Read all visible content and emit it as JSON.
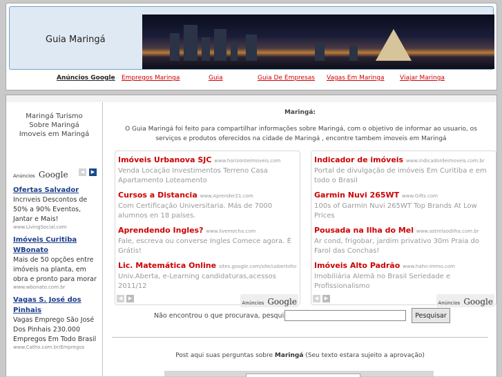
{
  "header": {
    "site_title": "Guia Maringá"
  },
  "nav": {
    "ads_label": "Anúncios Google",
    "links": [
      "Empregos Maringa",
      "Guia",
      "Guia De Empresas",
      "Vagas Em Maringa",
      "Viajar Maringa"
    ]
  },
  "sidebar": {
    "links": [
      "Maringá Turismo",
      "Sobre Maringá",
      "Imoveis em Maringá"
    ],
    "ads_label": "Anúncios",
    "google_label": "Google",
    "ads": [
      {
        "title": "Ofertas Salvador",
        "text": "Incrıveis Descontos de 50% a 90% Eventos, Jantar e Mais!",
        "url": "www.LivingSocial.com"
      },
      {
        "title": "Imóveis Curitiba WBonato",
        "text": "Mais de 50 opções entre imóveis na planta, em obra e pronto para morar",
        "url": "www.wbonato.com.br"
      },
      {
        "title": "Vagas S. José dos Pinhais",
        "text": "Vagas Emprego São José Dos Pinhais 230.000 Empregos Em Todo Brasil",
        "url": "www.Catho.com.br/Empregos"
      }
    ]
  },
  "main": {
    "title": "Maringá:",
    "intro": "O Guia Maringá foi feito para compartilhar informações sobre Maringá, com o objetivo de informar ao usuario, os serviços e produtos oferecidos na cidade de Maringá , encontre tambem imoveis em Maringá",
    "ads_label": "Anúncios",
    "google_label": "Google",
    "ads_left": [
      {
        "title": "Imóveis Urbanova SJC",
        "url": "www.horizonteimoveis.com",
        "text": "Venda Locação Investimentos Terreno Casa Apartamento Loteamento"
      },
      {
        "title": "Cursos a Distancia",
        "url": "www.Aprender21.com",
        "text": "Com Certificação Universitaria. Más de 7000 alumnos en 18 países."
      },
      {
        "title": "Aprendendo Ingles?",
        "url": "www.livemocha.com",
        "text": "Fale, escreva ou converse Ingles Comece agora. É Grátis!"
      },
      {
        "title": "Lic. Matemática Online",
        "url": "sites.google.com/site/usbertofor...",
        "text": "Univ.Aberta, e-Learning candidaturas,acessos 2011/12"
      }
    ],
    "ads_right": [
      {
        "title": "Indicador de imóveis",
        "url": "www.indicadordeimoveis.com.br",
        "text": "Portal de divulgação de imóveis Em Curitiba e em todo o Brasil"
      },
      {
        "title": "Garmin Nuvi 265WT",
        "url": "www.Gifts.com",
        "text": "100s of Garmin Nuvi 265WT Top Brands At Low Prices"
      },
      {
        "title": "Pousada na Ilha do Mel",
        "url": "www.astrelaodilha.com.br",
        "text": "Ar cond, frigobar, jardim privativo 30m Praia do Farol das Conchas!"
      },
      {
        "title": "Imóveis Alto Padrão",
        "url": "www.hahn-immo.com",
        "text": "Imobiliária Alemã no Brasil Seriedade e Profissionalismo"
      }
    ],
    "search_label": "Não encontrou o que procurava, pesquise:",
    "search_value": "",
    "search_button": "Pesquisar",
    "post_prefix": "Post aqui suas perguntas sobre",
    "post_city": "Maringá",
    "post_suffix": "(Seu texto estara sujeito a aprovação)"
  },
  "icons": {
    "prev": "chevron-left-icon",
    "next": "chevron-right-icon"
  },
  "colors": {
    "ad_title": "#cc0000",
    "sidebar_ad_title": "#1a3c8a",
    "arrow_active": "#1a4a8a"
  }
}
